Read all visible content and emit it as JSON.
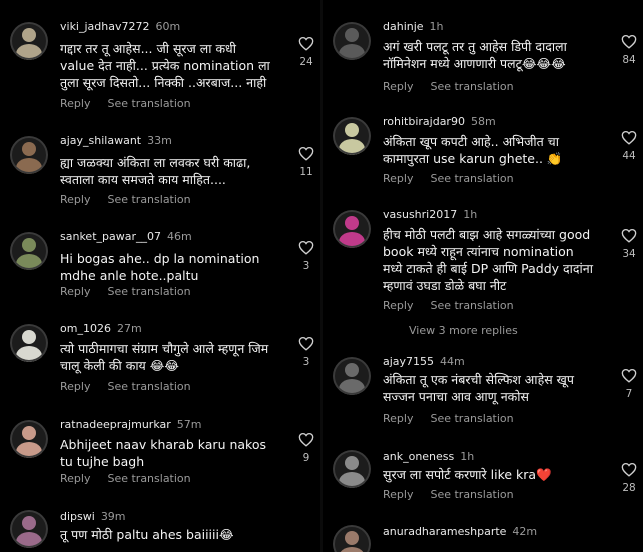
{
  "left": [
    {
      "user": "viki_jadhav7272",
      "time": "60m",
      "text": "गद्दार तर तू आहेस... जी सूरज ला कधी value देत नाही... प्रत्येक nomination ला तुला सूरज दिसतो... निक्की ..अरबाज... नाही",
      "likes": "24",
      "avatar_color": "#b0a48a"
    },
    {
      "user": "ajay_shilawant",
      "time": "33m",
      "text": "ह्या जळक्या अंकिता ला लवकर घरी काढा, स्वताला काय समजते काय माहित....",
      "likes": "11",
      "avatar_color": "#8a6a50"
    },
    {
      "user": "sanket_pawar__07",
      "time": "46m",
      "text": "Hi bogas ahe.. dp la nomination mdhe anle hote..paltu",
      "likes": "3",
      "avatar_color": "#7a8a5a"
    },
    {
      "user": "om_1026",
      "time": "27m",
      "text": "त्यो पाठीमागचा संग्राम चौगुले आले म्हणून जिम चालू केली की काय 😂😂",
      "likes": "3",
      "avatar_color": "#d8d8d0"
    },
    {
      "user": "ratnadeeprajmurkar",
      "time": "57m",
      "text": "Abhijeet  naav kharab  karu nakos tu tujhe bagh",
      "likes": "9",
      "avatar_color": "#c89a8a"
    },
    {
      "user": "dipswi",
      "time": "39m",
      "text": "तू पण मोठी paltu ahes baiiiii😂",
      "likes": "",
      "avatar_color": "#9a6a8a"
    }
  ],
  "right": [
    {
      "user": "dahinje",
      "time": "1h",
      "text": "अगं खरी पलटू तर तु आहेस डिपी दादाला नॉमिनेशन मध्ये आणणारी पलटू😂😂😂",
      "likes": "84",
      "avatar_color": "#5a5a5a"
    },
    {
      "user": "rohitbirajdar90",
      "time": "58m",
      "text": "अंकिता खूप कपटी आहे.. अभिजीत चा कामापुरता use karun ghete.. 👏",
      "likes": "44",
      "avatar_color": "#c8c8a0"
    },
    {
      "user": "vasushri2017",
      "time": "1h",
      "text": "हीच मोठी पलटी बाझ आहे सगळ्यांच्या good book मध्ये राहून त्यांनाच nomination मध्ये टाकते ही बाई DP आणि Paddy दादांना म्हणावं उघडा डोळे बघा नीट",
      "likes": "34",
      "avatar_color": "#c03a8a"
    },
    {
      "user": "ajay7155",
      "time": "44m",
      "text": "अंकिता तू एक नंबरची सेल्फिश आहेस खूप सज्जन पनाचा आव आणू नकोस",
      "likes": "7",
      "avatar_color": "#6a6a6a"
    },
    {
      "user": "ank_oneness",
      "time": "1h",
      "text": "सुरज ला सपोर्ट करणारे like kra❤️",
      "likes": "28",
      "avatar_color": "#8a8a8a"
    },
    {
      "user": "anuradharameshparte",
      "time": "42m",
      "text": "",
      "likes": "",
      "avatar_color": "#9a7a6a"
    }
  ],
  "view_more": "View 3 more replies",
  "reply_label": "Reply",
  "translate_label": "See translation"
}
